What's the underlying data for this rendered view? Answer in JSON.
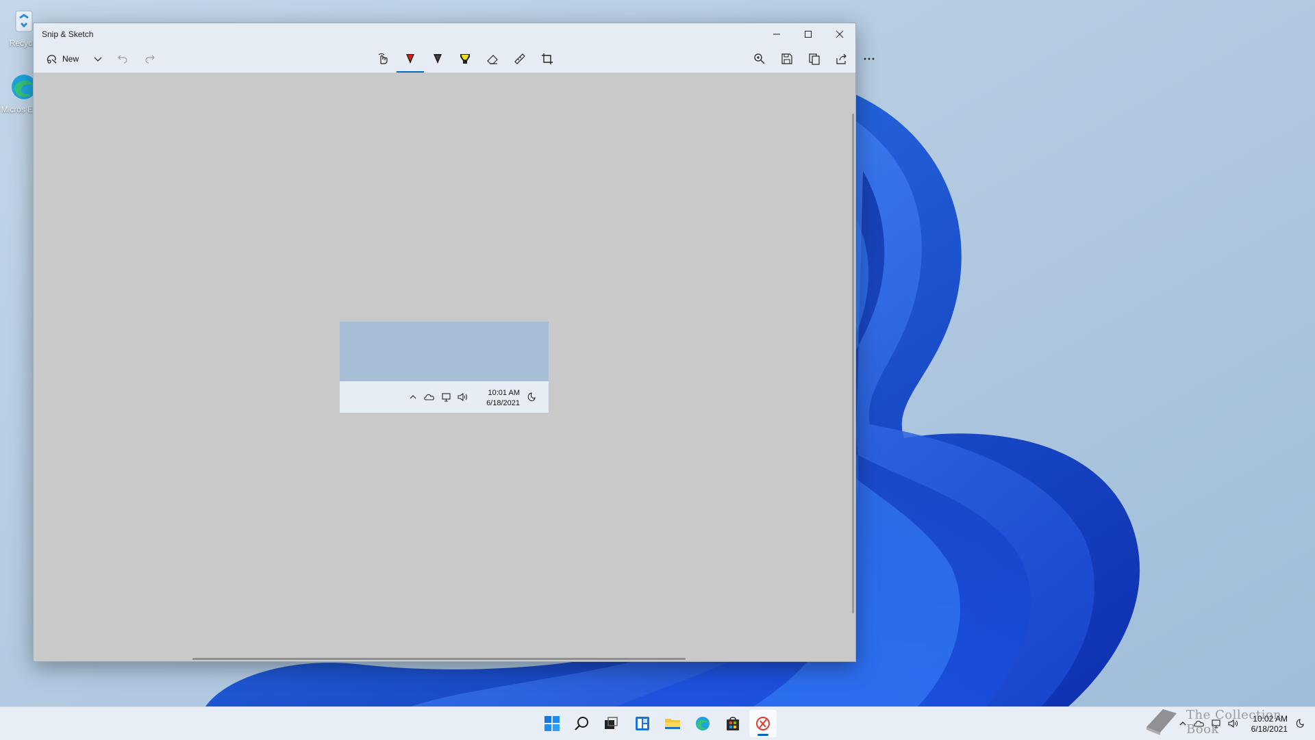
{
  "colors": {
    "accent": "#0067c0",
    "canvas": "#c9c9c9",
    "chrome": "#e6ecf3"
  },
  "desktop": {
    "icons": [
      {
        "label": "Recycle",
        "icon": "recycle-bin-icon"
      },
      {
        "label": "Micros Edge",
        "icon": "edge-icon"
      }
    ]
  },
  "window": {
    "title": "Snip & Sketch",
    "controls": [
      "minimize-icon",
      "maximize-icon",
      "close-icon"
    ]
  },
  "toolbar": {
    "new_label": "New",
    "left_tools": [
      "new-snip-icon",
      "chevron-down-icon",
      "undo-icon",
      "redo-icon"
    ],
    "center_tools": [
      "touch-writing-icon",
      "ballpoint-pen-icon",
      "pencil-icon",
      "highlighter-icon",
      "eraser-icon",
      "ruler-icon",
      "crop-icon"
    ],
    "active_tool": "ballpoint-pen-icon",
    "right_tools": [
      "zoom-icon",
      "save-icon",
      "copy-icon",
      "share-icon",
      "more-icon"
    ]
  },
  "snip": {
    "time": "10:01 AM",
    "date": "6/18/2021",
    "tray_icons": [
      "chevron-up-icon",
      "onedrive-icon",
      "network-icon",
      "volume-icon",
      "focus-assist-icon"
    ]
  },
  "taskbar": {
    "apps": [
      "start-icon",
      "search-icon",
      "task-view-icon",
      "widgets-icon",
      "file-explorer-icon",
      "edge-icon",
      "store-icon",
      "snip-sketch-icon"
    ],
    "active_app": "snip-sketch-icon",
    "time": "10:02 AM",
    "date": "6/18/2021",
    "tray_icons": [
      "chevron-up-icon",
      "onedrive-icon",
      "network-icon",
      "volume-icon",
      "focus-assist-icon"
    ]
  },
  "watermark": "The Collection Book"
}
